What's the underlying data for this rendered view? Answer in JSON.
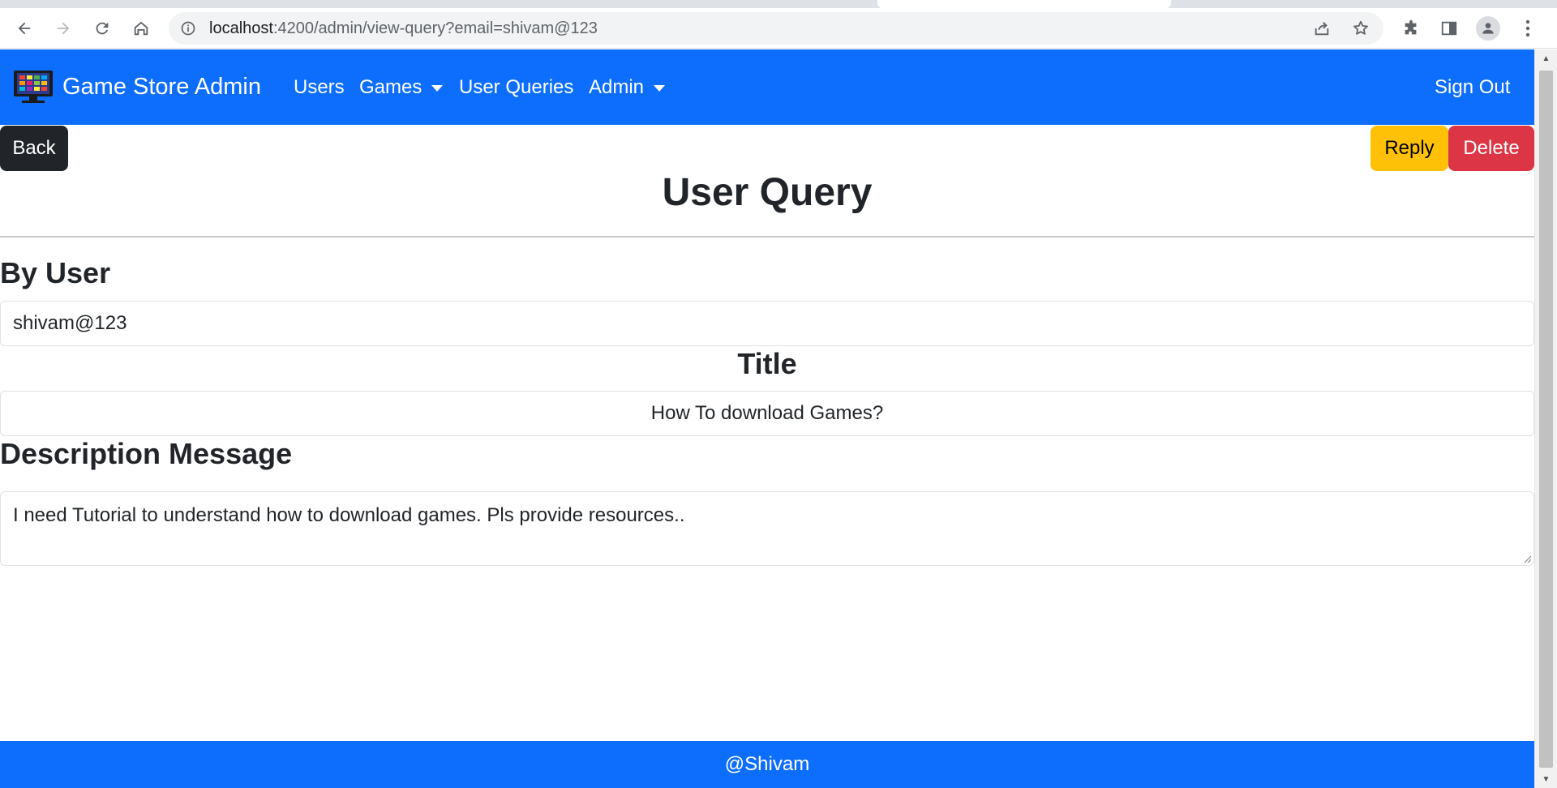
{
  "browser": {
    "url_host": "localhost",
    "url_path": ":4200/admin/view-query?email=shivam@123"
  },
  "navbar": {
    "brand": "Game Store Admin",
    "items": [
      {
        "label": "Users"
      },
      {
        "label": "Games"
      },
      {
        "label": "User Queries"
      },
      {
        "label": "Admin"
      }
    ],
    "sign_out": "Sign Out"
  },
  "actions": {
    "back": "Back",
    "reply": "Reply",
    "delete": "Delete"
  },
  "page": {
    "title": "User Query",
    "by_user_label": "By User",
    "by_user_value": "shivam@123",
    "title_label": "Title",
    "title_value": "How To download Games?",
    "description_label": "Description Message",
    "description_value": "I need Tutorial to understand how to download games. Pls provide resources.."
  },
  "footer": {
    "text": "@Shivam"
  },
  "colors": {
    "primary": "#0d6efd",
    "dark": "#212529",
    "warning": "#ffc107",
    "danger": "#dc3545"
  }
}
